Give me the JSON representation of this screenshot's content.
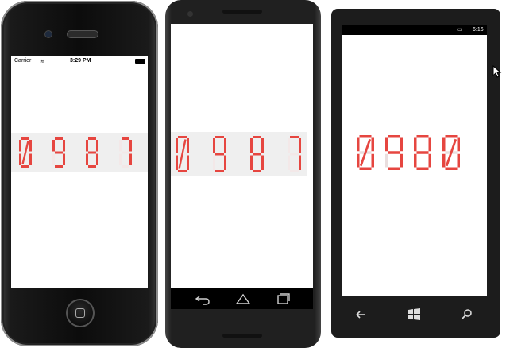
{
  "iphone": {
    "status": {
      "carrier": "Carrier",
      "time": "3:29 PM"
    },
    "display": {
      "digits": [
        "0",
        "9",
        "8",
        "7"
      ]
    }
  },
  "android": {
    "display": {
      "digits": [
        "0",
        "9",
        "8",
        "7"
      ]
    }
  },
  "windows_phone": {
    "status": {
      "time": "6:16"
    },
    "display": {
      "digits": [
        "0",
        "9",
        "8",
        "0"
      ]
    }
  },
  "colors": {
    "segment_on": "#e64640",
    "segment_off": "#f3e8e8"
  }
}
